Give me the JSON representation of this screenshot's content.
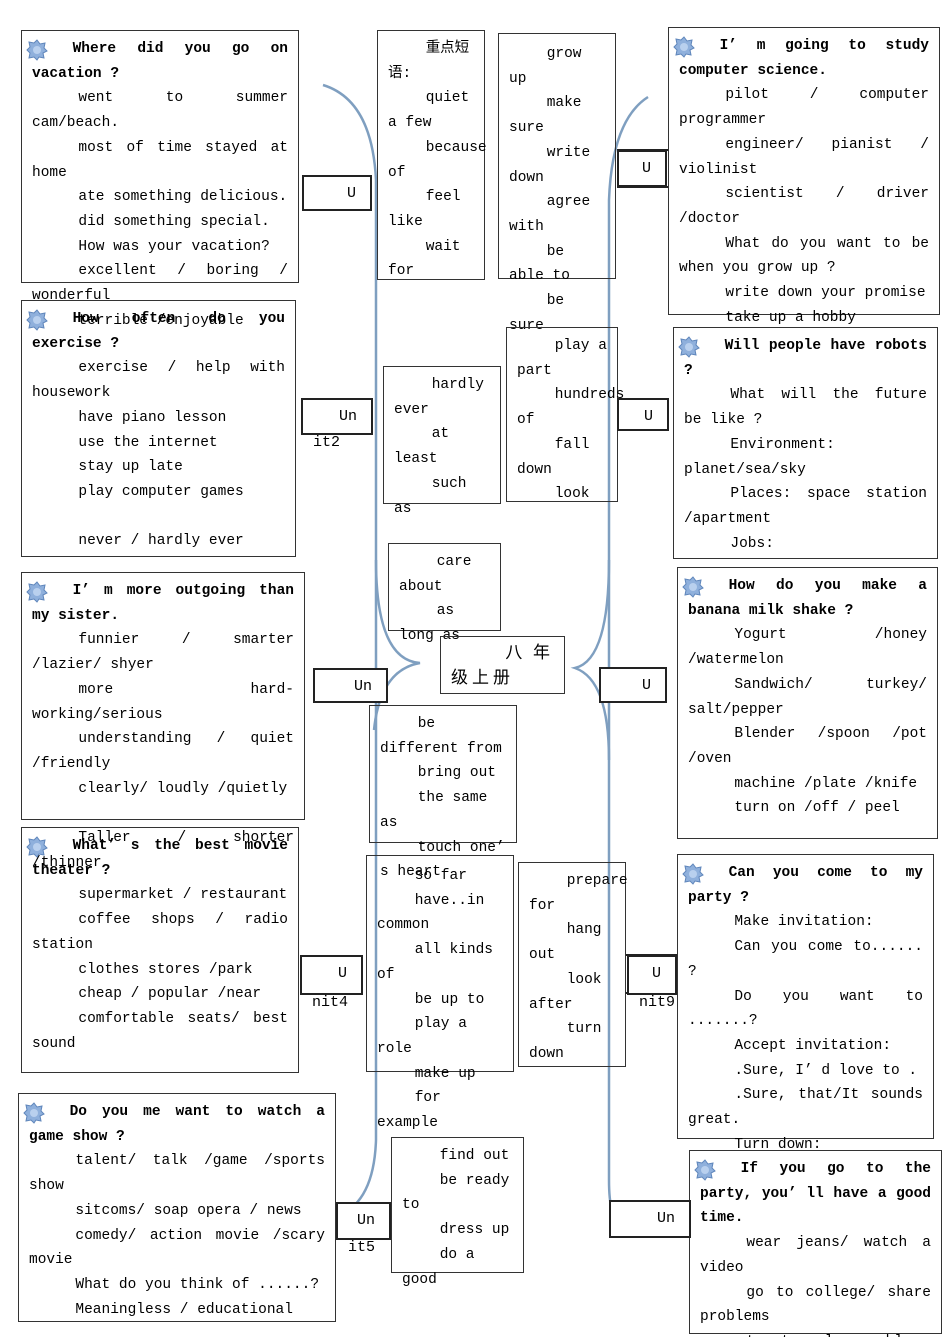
{
  "colors": {
    "connector": "#7f9fc0",
    "border": "#333333",
    "icon": "#8fb0dc"
  },
  "boxes": [
    {
      "id": "l1",
      "icon": true,
      "title": "Where did you go on vacation ?",
      "paras": [
        "went to summer cam/beach.",
        "most of time stayed at home",
        "ate something delicious.",
        "did something special.",
        "How was your vacation?",
        "excellent / boring / wonderful",
        "terrible /enjoyable"
      ]
    },
    {
      "id": "l2",
      "icon": true,
      "title": "How often do you exercise ?",
      "paras": [
        "exercise / help with housework",
        "have piano lesson",
        "use the internet",
        "stay up late",
        "play computer games",
        "",
        "never / hardly ever"
      ]
    },
    {
      "id": "l3",
      "icon": true,
      "title": "I’ m more outgoing than my sister.",
      "paras": [
        "funnier / smarter /lazier/ shyer",
        "more hard-working/serious",
        "understanding / quiet /friendly",
        "clearly/ loudly /quietly",
        "",
        "Taller / shorter /thinner"
      ]
    },
    {
      "id": "l4",
      "icon": true,
      "title": "What’ s the best movie theater ?",
      "paras": [
        "supermarket / restaurant",
        "coffee shops / radio station",
        "clothes stores /park",
        "cheap / popular /near",
        "comfortable seats/ best sound"
      ]
    },
    {
      "id": "l5",
      "icon": true,
      "title": "Do you me want to watch a game show ?",
      "paras": [
        "talent/ talk /game /sports show",
        "sitcoms/ soap opera / news",
        "comedy/ action movie /scary movie",
        "What do you think of ......?",
        "Meaningless / educational"
      ]
    },
    {
      "id": "r1",
      "icon": true,
      "title": "I’ m going to study computer science.",
      "paras": [
        "pilot / computer programmer",
        "engineer/ pianist / violinist",
        "scientist / driver /doctor",
        "What do you want to be when you grow up ?",
        "write down your promise",
        "take up a hobby"
      ]
    },
    {
      "id": "r2",
      "icon": true,
      "title": "Will people have robots ?",
      "paras": [
        "What will the future be like ?",
        "Environment: planet/sea/sky",
        "Places: space station /apartment",
        "Jobs:"
      ]
    },
    {
      "id": "r3",
      "icon": true,
      "title": "How do you make a banana milk shake ?",
      "paras": [
        "Yogurt /honey /watermelon",
        "Sandwich/ turkey/ salt/pepper",
        "Blender /spoon /pot /oven",
        "machine /plate /knife",
        "turn on /off / peel"
      ]
    },
    {
      "id": "r4",
      "icon": true,
      "title": "Can you come to my party ?",
      "paras": [
        "Make invitation:",
        "Can you come to...... ?",
        "Do you want to .......?",
        "Accept invitation:",
        ".Sure, I’ d love to .",
        ".Sure, that/It sounds great.",
        "Turn down:"
      ]
    },
    {
      "id": "r5",
      "icon": true,
      "title": "If you go to the party, you’ ll have a good time.",
      "paras": [
        "wear jeans/ watch a video",
        "go to college/ share problems",
        "try to solve problems"
      ]
    },
    {
      "id": "c1",
      "icon": false,
      "title": "",
      "paras": [
        "重点短语:",
        "quiet a few",
        "because of",
        "feel like",
        "wait for"
      ]
    },
    {
      "id": "c2",
      "icon": false,
      "title": "",
      "paras": [
        "grow up",
        "make sure",
        "write down",
        "agree with",
        "be able to",
        "be sure"
      ]
    },
    {
      "id": "c3",
      "icon": false,
      "title": "",
      "paras": [
        "hardly ever",
        "at least",
        "such as"
      ]
    },
    {
      "id": "c4",
      "icon": false,
      "title": "",
      "paras": [
        "play a part",
        "hundreds of",
        "fall down",
        "look"
      ]
    },
    {
      "id": "c5",
      "icon": false,
      "title": "",
      "paras": [
        "care about",
        "as long as"
      ]
    },
    {
      "id": "c6",
      "icon": false,
      "title": "",
      "paras": [
        "八年级上册"
      ]
    },
    {
      "id": "c7",
      "icon": false,
      "title": "",
      "paras": [
        "be different from",
        "bring out",
        "the same as",
        "touch one’ s heart"
      ]
    },
    {
      "id": "c8",
      "icon": false,
      "title": "",
      "paras": [
        "so far",
        "have..in common",
        "all kinds of",
        "be up to",
        "play a role",
        "make up",
        "for example"
      ]
    },
    {
      "id": "c9",
      "icon": false,
      "title": "",
      "paras": [
        "prepare for",
        "hang out",
        "look after",
        "turn down"
      ]
    },
    {
      "id": "c10",
      "icon": false,
      "title": "",
      "paras": [
        "find out",
        "be ready to",
        "dress up",
        "do a good"
      ]
    }
  ],
  "units": [
    {
      "id": "u1",
      "label": "U",
      "suffix": ""
    },
    {
      "id": "u2",
      "label": "U",
      "suffix": ""
    },
    {
      "id": "u3",
      "label": "Un",
      "suffix": "it2"
    },
    {
      "id": "u4",
      "label": "U",
      "suffix": ""
    },
    {
      "id": "u5",
      "label": "Un",
      "suffix": ""
    },
    {
      "id": "u6",
      "label": "U",
      "suffix": ""
    },
    {
      "id": "u7",
      "label": "U",
      "suffix": "nit4"
    },
    {
      "id": "u8",
      "label": "U",
      "suffix": "nit9"
    },
    {
      "id": "u9",
      "label": "Un",
      "suffix": "it5"
    },
    {
      "id": "u10",
      "label": "Un",
      "suffix": ""
    }
  ]
}
